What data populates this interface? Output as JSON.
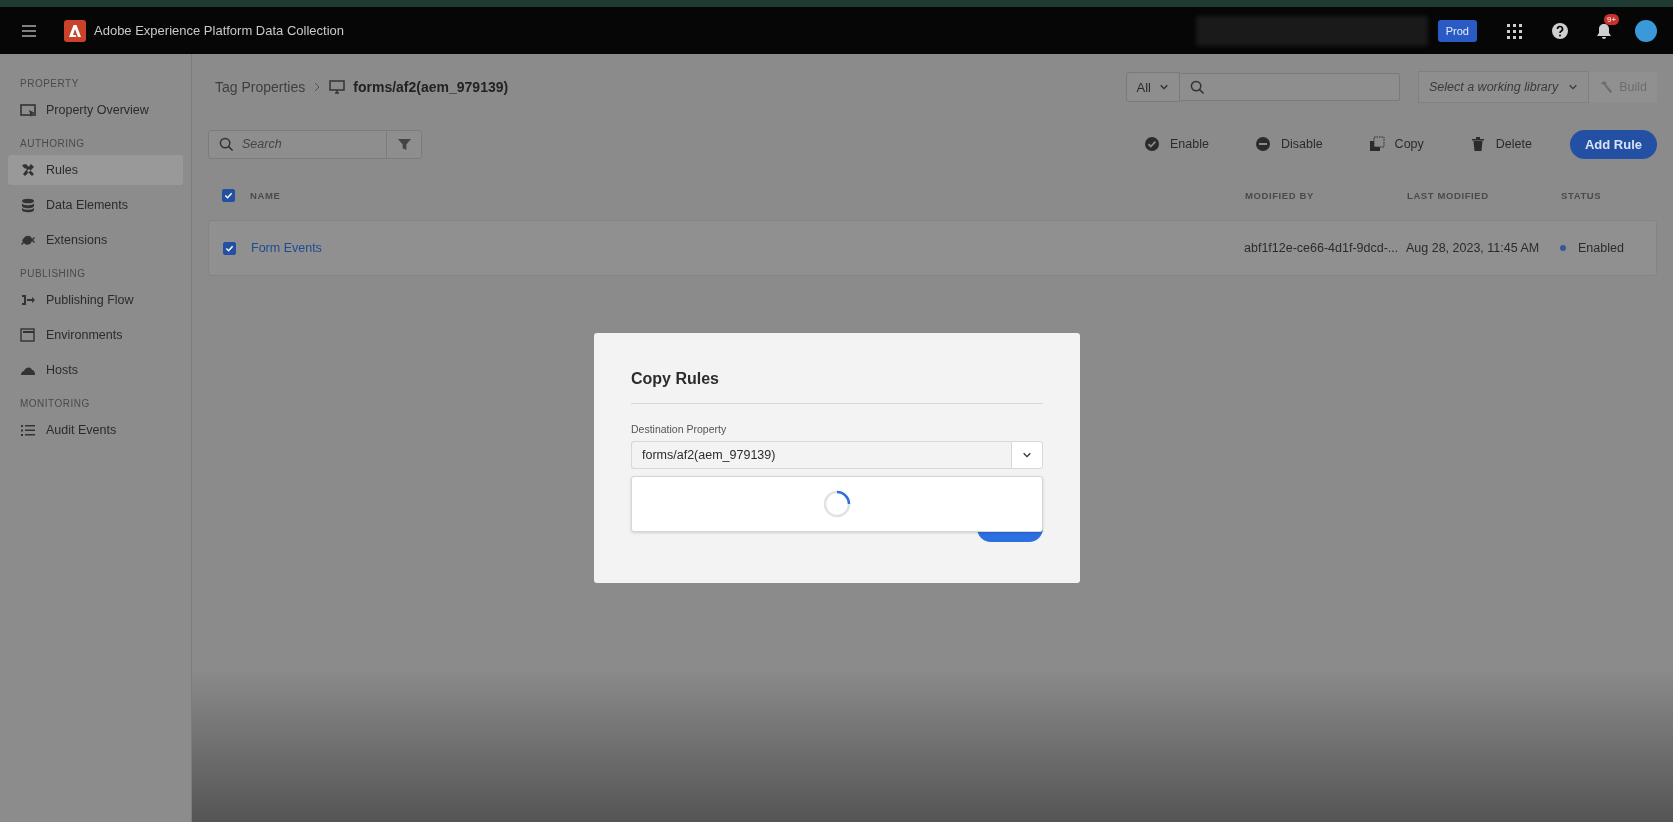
{
  "top_bar": {
    "app_title": "Adobe Experience Platform Data Collection",
    "environment_badge": "Prod",
    "notification_count": "9+"
  },
  "sidebar": {
    "sections": [
      {
        "heading": "PROPERTY",
        "items": [
          {
            "label": "Property Overview",
            "kind": "overview",
            "selected": false
          }
        ]
      },
      {
        "heading": "AUTHORING",
        "items": [
          {
            "label": "Rules",
            "kind": "tools",
            "selected": true
          },
          {
            "label": "Data Elements",
            "kind": "database",
            "selected": false
          },
          {
            "label": "Extensions",
            "kind": "plug",
            "selected": false
          }
        ]
      },
      {
        "heading": "PUBLISHING",
        "items": [
          {
            "label": "Publishing Flow",
            "kind": "flow",
            "selected": false
          },
          {
            "label": "Environments",
            "kind": "windows",
            "selected": false
          },
          {
            "label": "Hosts",
            "kind": "cloud",
            "selected": false
          }
        ]
      },
      {
        "heading": "MONITORING",
        "items": [
          {
            "label": "Audit Events",
            "kind": "list",
            "selected": false
          }
        ]
      }
    ]
  },
  "breadcrumb": {
    "parent": "Tag Properties",
    "current": "forms/af2(aem_979139)"
  },
  "header_controls": {
    "scope": "All",
    "library_placeholder": "Select a working library",
    "build": {
      "label": "Build",
      "disabled": true
    }
  },
  "toolbar": {
    "search_placeholder": "Search",
    "actions": [
      {
        "label": "Enable",
        "kind": "check"
      },
      {
        "label": "Disable",
        "kind": "minus"
      },
      {
        "label": "Copy",
        "kind": "copy"
      },
      {
        "label": "Delete",
        "kind": "trash"
      }
    ],
    "primary": "Add Rule"
  },
  "table": {
    "columns": [
      "NAME",
      "MODIFIED BY",
      "LAST MODIFIED",
      "STATUS"
    ],
    "all_checked": true,
    "rows": [
      {
        "checked": true,
        "name": "Form Events",
        "modified_by": "abf1f12e-ce66-4d1f-9dcd-...",
        "last_modified": "Aug 28, 2023, 11:45 AM",
        "status": "Enabled",
        "color": "#34569a"
      }
    ]
  },
  "dialog": {
    "title": "Copy Rules",
    "field_label": "Destination Property",
    "value": "forms/af2(aem_979139)",
    "loading": true
  }
}
